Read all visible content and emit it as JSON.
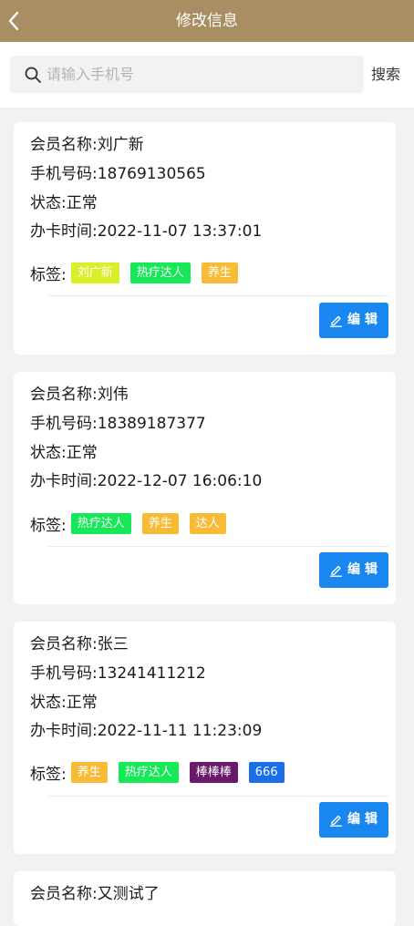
{
  "header": {
    "title": "修改信息"
  },
  "search": {
    "placeholder": "请输入手机号",
    "value": "",
    "button_label": "搜索"
  },
  "colors": {
    "header_bg": "#a88e62",
    "edit_button": "#1a86f0",
    "tag_yellow_green": "#d9ef27",
    "tag_green": "#16e857",
    "tag_orange": "#f7bb36",
    "tag_purple": "#6a1a6d",
    "tag_blue": "#1a6ee8"
  },
  "members": [
    {
      "name": "会员名称:刘广新",
      "phone": "手机号码:18769130565",
      "status": "状态:正常",
      "card_time": "办卡时间:2022-11-07 13:37:01",
      "tags_label": "标签:",
      "tags": [
        {
          "text": "刘广新",
          "color": "#d9ef27"
        },
        {
          "text": "热疗达人",
          "color": "#16e857"
        },
        {
          "text": "养生",
          "color": "#f7bb36"
        }
      ],
      "edit_label": "编辑"
    },
    {
      "name": "会员名称:刘伟",
      "phone": "手机号码:18389187377",
      "status": "状态:正常",
      "card_time": "办卡时间:2022-12-07 16:06:10",
      "tags_label": "标签:",
      "tags": [
        {
          "text": "热疗达人",
          "color": "#16e857"
        },
        {
          "text": "养生",
          "color": "#f7bb36"
        },
        {
          "text": "达人",
          "color": "#f7bb36"
        }
      ],
      "edit_label": "编辑"
    },
    {
      "name": "会员名称:张三",
      "phone": "手机号码:13241411212",
      "status": "状态:正常",
      "card_time": "办卡时间:2022-11-11 11:23:09",
      "tags_label": "标签:",
      "tags": [
        {
          "text": "养生",
          "color": "#f7bb36"
        },
        {
          "text": "热疗达人",
          "color": "#16e857"
        },
        {
          "text": "棒棒棒",
          "color": "#6a1a6d"
        },
        {
          "text": "666",
          "color": "#1a6ee8"
        }
      ],
      "edit_label": "编辑"
    },
    {
      "name": "会员名称:又测试了"
    }
  ]
}
